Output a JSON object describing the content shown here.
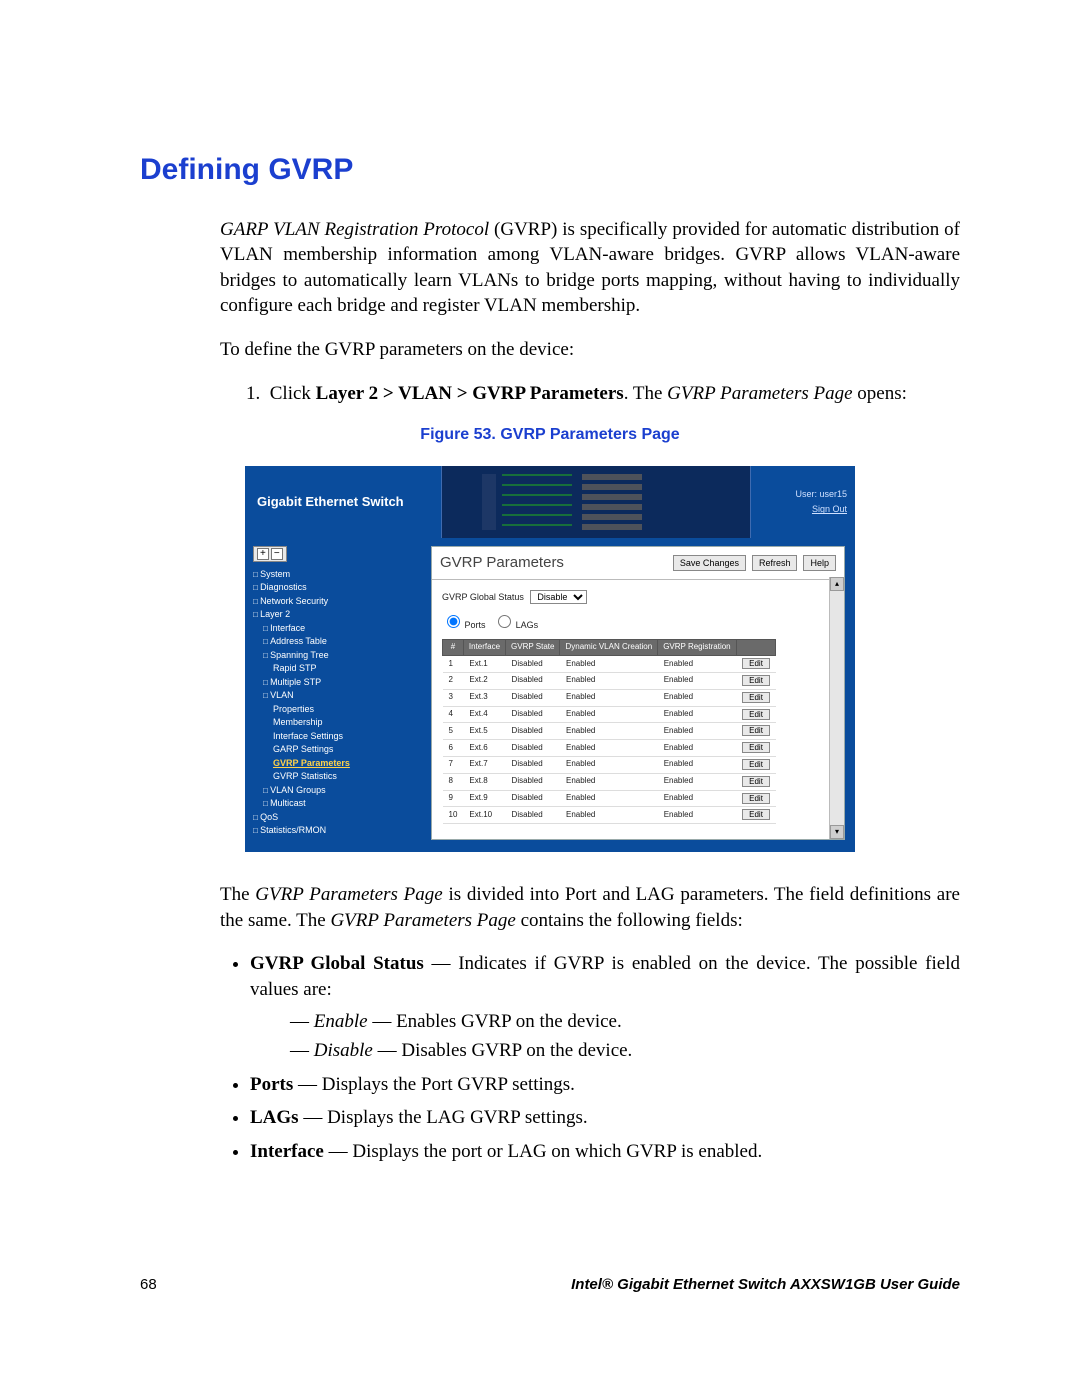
{
  "heading": "Defining GVRP",
  "intro": {
    "ital": "GARP VLAN Registration Protocol",
    "rest": " (GVRP) is specifically provided for automatic distribution of VLAN membership information among VLAN-aware bridges. GVRP allows VLAN-aware bridges to automatically learn VLANs to bridge ports mapping, without having to individually configure each bridge and register VLAN membership."
  },
  "toDefine": "To define the GVRP parameters on the device:",
  "step": {
    "num": "1.",
    "pre": "Click ",
    "bold": "Layer 2 > VLAN > GVRP Parameters",
    "mid": ". The ",
    "ital": "GVRP Parameters Page",
    "post": " opens:"
  },
  "figureCaption": "Figure 53. GVRP Parameters Page",
  "screenshot": {
    "productTitle": "Gigabit Ethernet Switch",
    "user": "User: user15",
    "signOut": "Sign Out",
    "nav": [
      {
        "label": "System",
        "lvl": "lvl0 bullet"
      },
      {
        "label": "Diagnostics",
        "lvl": "lvl0 bullet"
      },
      {
        "label": "Network Security",
        "lvl": "lvl0 bullet"
      },
      {
        "label": "Layer 2",
        "lvl": "lvl0 bullet"
      },
      {
        "label": "Interface",
        "lvl": "lvl1 bullet"
      },
      {
        "label": "Address Table",
        "lvl": "lvl1 bullet"
      },
      {
        "label": "Spanning Tree",
        "lvl": "lvl1 bullet"
      },
      {
        "label": "Rapid STP",
        "lvl": "lvl2"
      },
      {
        "label": "Multiple STP",
        "lvl": "lvl1 bullet"
      },
      {
        "label": "VLAN",
        "lvl": "lvl1 bullet"
      },
      {
        "label": "Properties",
        "lvl": "lvl2"
      },
      {
        "label": "Membership",
        "lvl": "lvl2"
      },
      {
        "label": "Interface Settings",
        "lvl": "lvl2"
      },
      {
        "label": "GARP Settings",
        "lvl": "lvl2"
      },
      {
        "label": "GVRP Parameters",
        "lvl": "lvl2 sel"
      },
      {
        "label": "GVRP Statistics",
        "lvl": "lvl2"
      },
      {
        "label": "VLAN Groups",
        "lvl": "lvl1 bullet"
      },
      {
        "label": "Multicast",
        "lvl": "lvl1 bullet"
      },
      {
        "label": "QoS",
        "lvl": "lvl0 bullet"
      },
      {
        "label": "Statistics/RMON",
        "lvl": "lvl0 bullet"
      }
    ],
    "pageTitle": "GVRP Parameters",
    "btnSave": "Save Changes",
    "btnRefresh": "Refresh",
    "btnHelp": "Help",
    "globalStatusLabel": "GVRP Global Status",
    "globalStatusValue": "Disable",
    "radioPorts": "Ports",
    "radioLags": "LAGs",
    "cols": {
      "num": "#",
      "iface": "Interface",
      "state": "GVRP State",
      "dyn": "Dynamic VLAN Creation",
      "reg": "GVRP Registration",
      "edit": "Edit"
    },
    "rows": [
      {
        "n": "1",
        "iface": "Ext.1",
        "state": "Disabled",
        "dyn": "Enabled",
        "reg": "Enabled"
      },
      {
        "n": "2",
        "iface": "Ext.2",
        "state": "Disabled",
        "dyn": "Enabled",
        "reg": "Enabled"
      },
      {
        "n": "3",
        "iface": "Ext.3",
        "state": "Disabled",
        "dyn": "Enabled",
        "reg": "Enabled"
      },
      {
        "n": "4",
        "iface": "Ext.4",
        "state": "Disabled",
        "dyn": "Enabled",
        "reg": "Enabled"
      },
      {
        "n": "5",
        "iface": "Ext.5",
        "state": "Disabled",
        "dyn": "Enabled",
        "reg": "Enabled"
      },
      {
        "n": "6",
        "iface": "Ext.6",
        "state": "Disabled",
        "dyn": "Enabled",
        "reg": "Enabled"
      },
      {
        "n": "7",
        "iface": "Ext.7",
        "state": "Disabled",
        "dyn": "Enabled",
        "reg": "Enabled"
      },
      {
        "n": "8",
        "iface": "Ext.8",
        "state": "Disabled",
        "dyn": "Enabled",
        "reg": "Enabled"
      },
      {
        "n": "9",
        "iface": "Ext.9",
        "state": "Disabled",
        "dyn": "Enabled",
        "reg": "Enabled"
      },
      {
        "n": "10",
        "iface": "Ext.10",
        "state": "Disabled",
        "dyn": "Enabled",
        "reg": "Enabled"
      }
    ]
  },
  "afterShot": {
    "p1a": "The ",
    "p1i": "GVRP Parameters Page",
    "p1b": " is divided into Port and LAG parameters. The field definitions are the same. The ",
    "p1i2": "GVRP Parameters Page",
    "p1c": " contains the following fields:"
  },
  "fields": {
    "gvrpGlobal": {
      "name": "GVRP Global Status",
      "desc": " — Indicates if GVRP is enabled on the device. The possible field values are:",
      "enableName": "Enable",
      "enableDesc": " — Enables GVRP on the device.",
      "disableName": "Disable",
      "disableDesc": " — Disables GVRP on the device."
    },
    "ports": {
      "name": "Ports",
      "desc": " — Displays the Port GVRP settings."
    },
    "lags": {
      "name": "LAGs",
      "desc": " — Displays the LAG GVRP settings."
    },
    "iface": {
      "name": "Interface",
      "desc": " — Displays the port or LAG on which GVRP is enabled."
    }
  },
  "footer": {
    "page": "68",
    "pub": "Intel® Gigabit Ethernet Switch AXXSW1GB User Guide"
  }
}
